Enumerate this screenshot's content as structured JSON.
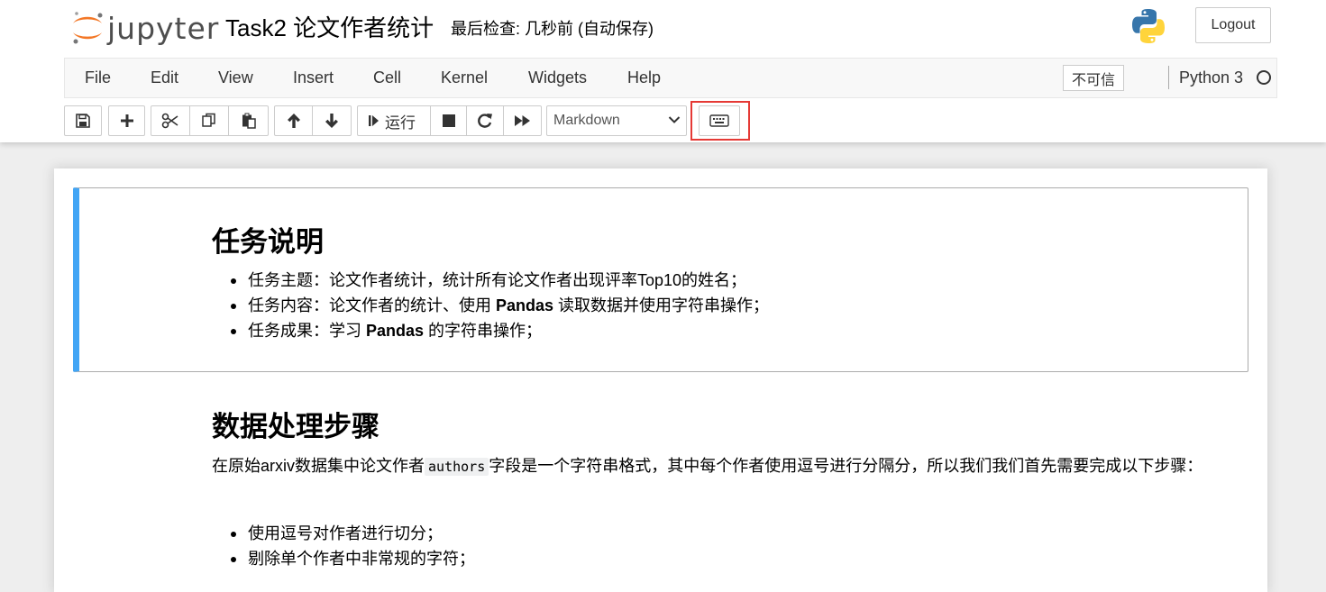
{
  "header": {
    "logo_text": "jupyter",
    "notebook_title": "Task2 论文作者统计",
    "checkpoint_status": "最后检查: 几秒前 (自动保存)",
    "logout_label": "Logout"
  },
  "menubar": {
    "items": [
      "File",
      "Edit",
      "View",
      "Insert",
      "Cell",
      "Kernel",
      "Widgets",
      "Help"
    ],
    "trust_label": "不可信",
    "kernel_name": "Python 3"
  },
  "toolbar": {
    "run_label": "运行",
    "cell_type": "Markdown"
  },
  "cells": {
    "task": {
      "heading": "任务说明",
      "items": [
        {
          "pre": "任务主题：论文作者统计，统计所有论文作者出现评率Top10的姓名；",
          "bold": "",
          "post": ""
        },
        {
          "pre": "任务内容：论文作者的统计、使用 ",
          "bold": "Pandas",
          "post": " 读取数据并使用字符串操作；"
        },
        {
          "pre": "任务成果：学习 ",
          "bold": "Pandas",
          "post": " 的字符串操作；"
        }
      ]
    },
    "steps": {
      "heading": "数据处理步骤",
      "para_pre": "在原始arxiv数据集中论文作者",
      "para_code": "authors",
      "para_post": "字段是一个字符串格式，其中每个作者使用逗号进行分隔分，所以我们我们首先需要完成以下步骤：",
      "items": [
        "使用逗号对作者进行切分；",
        "剔除单个作者中非常规的字符；"
      ]
    }
  },
  "colors": {
    "selected_cell_bar": "#42a5f5",
    "highlight_box": "#e53935",
    "jupyter_orange": "#f37726"
  }
}
